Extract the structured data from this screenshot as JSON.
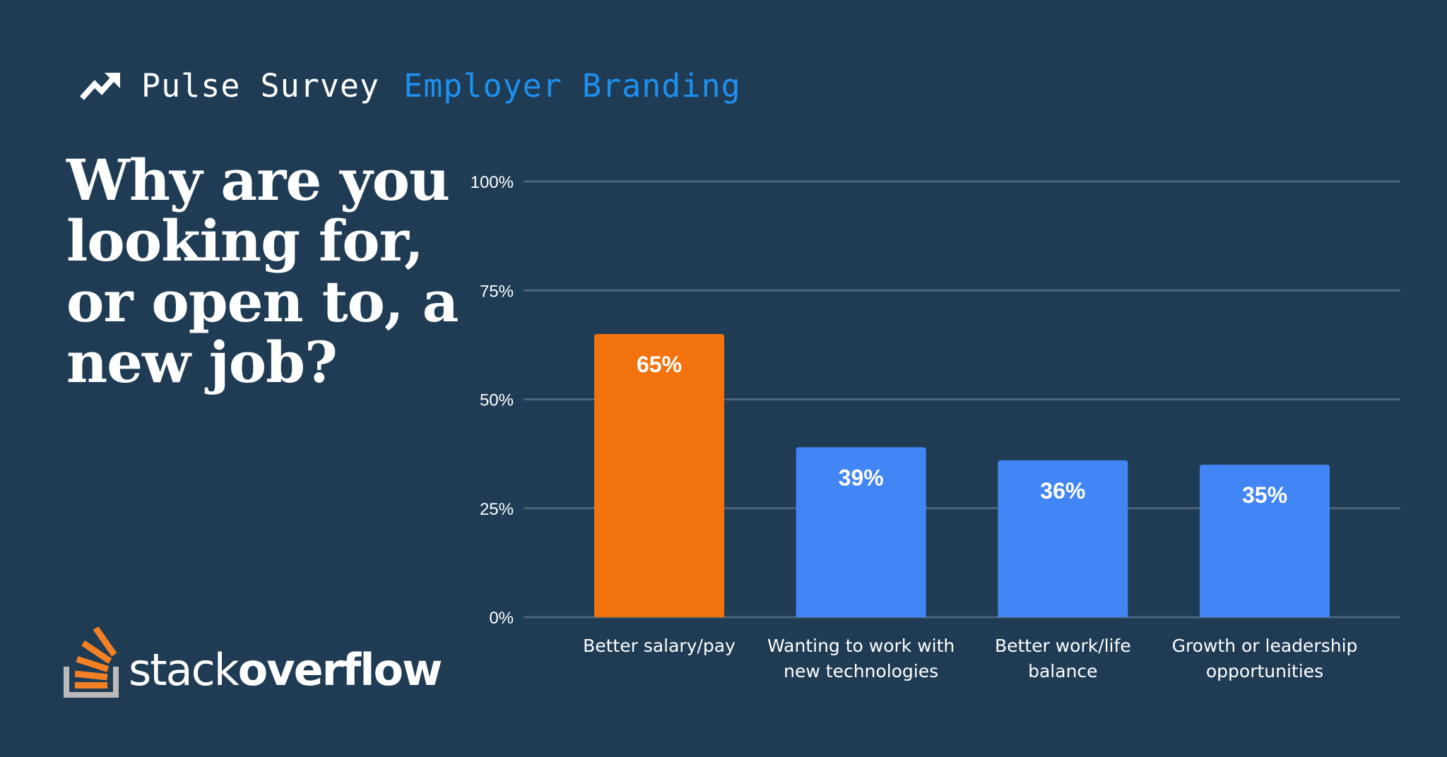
{
  "header": {
    "icon": "trending-up-icon",
    "series": "Pulse Survey",
    "topic": "Employer Branding"
  },
  "question": "Why are you looking for, or open to, a new job?",
  "brand": {
    "logo_icon": "stack-overflow-logo-icon",
    "name_light": "stack",
    "name_bold": "overflow"
  },
  "colors": {
    "background": "#1f3c54",
    "highlight_bar": "#f2730e",
    "bar": "#4285f4",
    "gridline": "#4d6478",
    "topic": "#1e90f0",
    "logo_orange": "#f48024",
    "logo_gray": "#bcbbbb"
  },
  "chart_data": {
    "type": "bar",
    "title": "Why are you looking for, or open to, a new job?",
    "xlabel": "",
    "ylabel": "",
    "ylim": [
      0,
      100
    ],
    "yticks": [
      0,
      25,
      50,
      75,
      100
    ],
    "ytick_labels": [
      "0%",
      "25%",
      "50%",
      "75%",
      "100%"
    ],
    "grid": true,
    "legend": "none",
    "categories": [
      [
        "Better salary/pay"
      ],
      [
        "Wanting to work with",
        "new technologies"
      ],
      [
        "Better work/life",
        "balance"
      ],
      [
        "Growth or leadership",
        "opportunities"
      ]
    ],
    "values": [
      65,
      39,
      36,
      35
    ],
    "data_labels": [
      "65%",
      "39%",
      "36%",
      "35%"
    ],
    "highlight_index": 0
  }
}
